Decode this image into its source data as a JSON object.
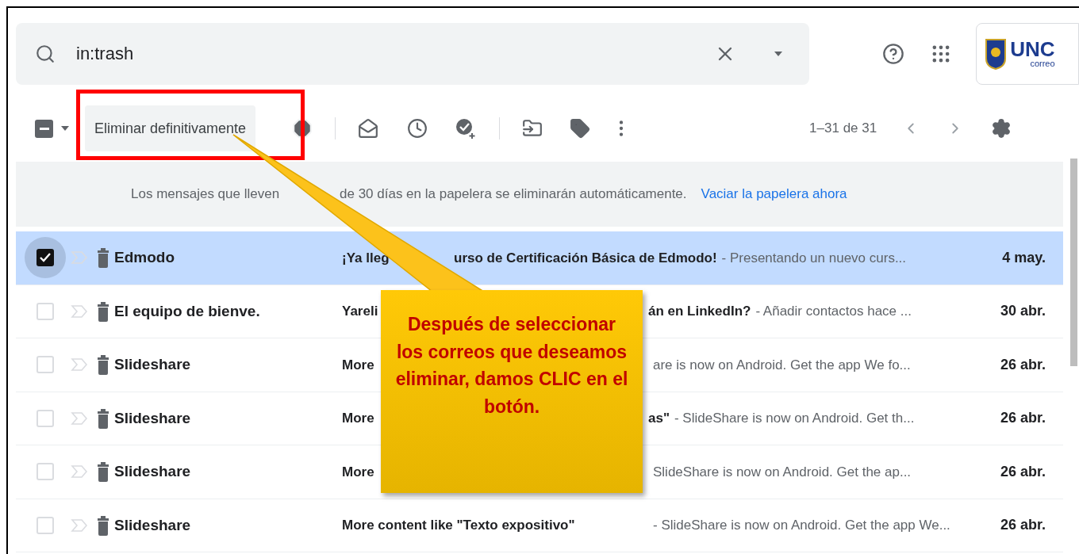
{
  "search": {
    "value": "in:trash"
  },
  "account": {
    "logo_text": "UNC",
    "logo_subtext": "correo"
  },
  "toolbar": {
    "select_all": {
      "indeterminate": true
    },
    "delete_button": "Eliminar definitivamente",
    "pager": "1–31 de 31"
  },
  "banner": {
    "text_start": "Los mensajes que lleven",
    "text_end": "de 30 días en la papelera se eliminarán automáticamente.",
    "link": "Vaciar la papelera ahora"
  },
  "rows": [
    {
      "selected": true,
      "sender": "Edmodo",
      "subject_start": "¡Ya lleg",
      "subject_end": "urso de Certificación Básica de Edmodo!",
      "snippet": "- Presentando un nuevo curs...",
      "date": "4 may."
    },
    {
      "selected": false,
      "sender": "El equipo de bienve.",
      "subject_start": "Yareli",
      "subject_end": "án en LinkedIn?",
      "snippet": "- Añadir contactos hace ...",
      "date": "30 abr."
    },
    {
      "selected": false,
      "sender": "Slideshare",
      "subject_start": "More",
      "snippet": "are is now on Android. Get the app We fo...",
      "date": "26 abr."
    },
    {
      "selected": false,
      "sender": "Slideshare",
      "subject_start": "More",
      "subject_end": "as\"",
      "snippet": "- SlideShare is now on Android. Get th...",
      "date": "26 abr."
    },
    {
      "selected": false,
      "sender": "Slideshare",
      "subject_start": "More",
      "snippet": "SlideShare is now on Android. Get the ap...",
      "date": "26 abr."
    },
    {
      "selected": false,
      "sender": "Slideshare",
      "subject_start": "More content like \"Texto expositivo\"",
      "snippet": "- SlideShare is now on Android. Get the app We...",
      "date": "26 abr."
    }
  ],
  "callout": {
    "text": "Después de seleccionar los correos que deseamos eliminar, damos CLIC en el botón."
  }
}
